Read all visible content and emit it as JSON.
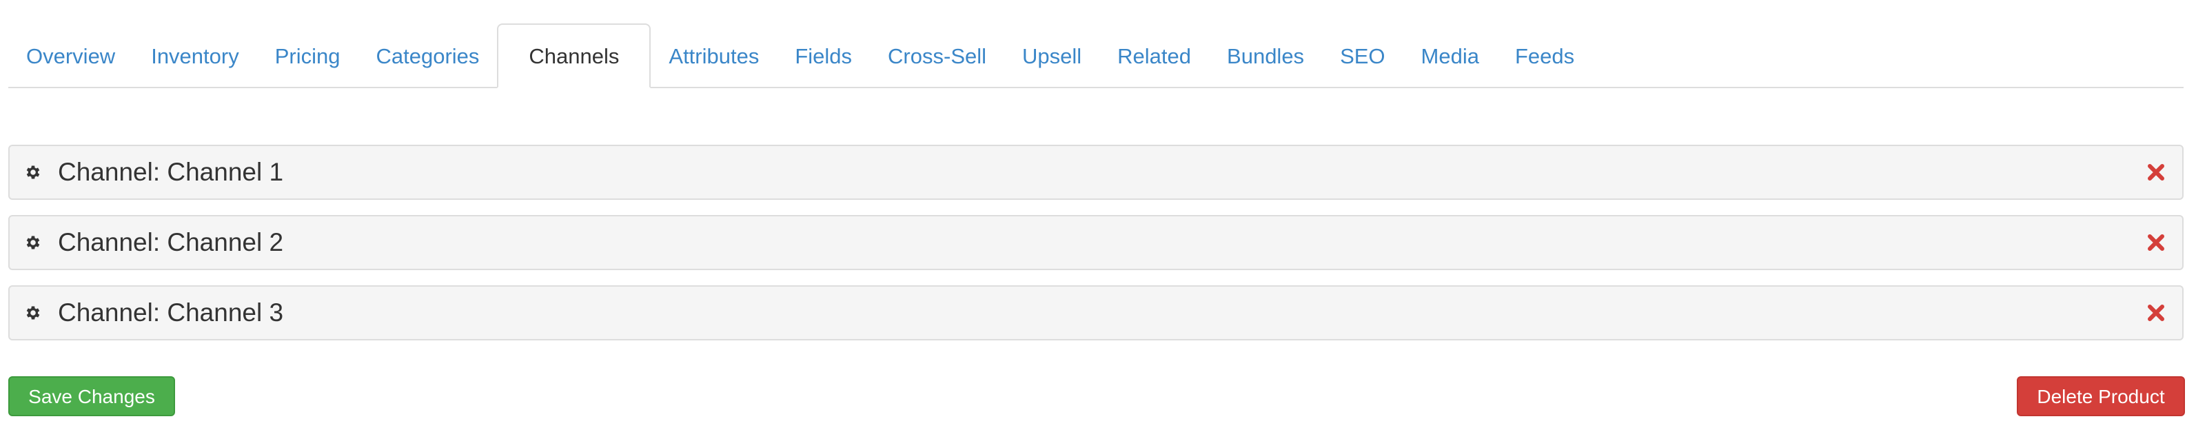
{
  "tabs": [
    {
      "label": "Overview",
      "active": false
    },
    {
      "label": "Inventory",
      "active": false
    },
    {
      "label": "Pricing",
      "active": false
    },
    {
      "label": "Categories",
      "active": false
    },
    {
      "label": "Channels",
      "active": true
    },
    {
      "label": "Attributes",
      "active": false
    },
    {
      "label": "Fields",
      "active": false
    },
    {
      "label": "Cross-Sell",
      "active": false
    },
    {
      "label": "Upsell",
      "active": false
    },
    {
      "label": "Related",
      "active": false
    },
    {
      "label": "Bundles",
      "active": false
    },
    {
      "label": "SEO",
      "active": false
    },
    {
      "label": "Media",
      "active": false
    },
    {
      "label": "Feeds",
      "active": false
    }
  ],
  "channels": [
    {
      "title": "Channel: Channel 1",
      "icon": "gear-icon",
      "remove_icon": "remove-icon"
    },
    {
      "title": "Channel: Channel 2",
      "icon": "gear-icon",
      "remove_icon": "remove-icon"
    },
    {
      "title": "Channel: Channel 3",
      "icon": "gear-icon",
      "remove_icon": "remove-icon"
    }
  ],
  "actions": {
    "save_label": "Save Changes",
    "delete_label": "Delete Product"
  },
  "colors": {
    "link": "#3a86c8",
    "save": "#4cae4c",
    "delete": "#d43f3a",
    "remove_icon": "#d43f3a"
  }
}
